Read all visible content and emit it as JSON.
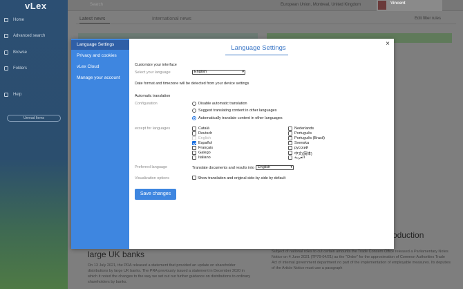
{
  "background": {
    "logo": "vLex",
    "nav": [
      "Home",
      "Advanced search",
      "Browse",
      "Folders",
      "Help"
    ],
    "updates_label": "Unread Items",
    "search_placeholder": "Search",
    "location": "European Union, Montreal, United Kingdom",
    "user_name": "Vincent",
    "tab_latest": "Latest news",
    "tab_international": "International news",
    "filter_label": "Edit filter rules",
    "headline_left": "large UK banks",
    "headline_right": "oduction",
    "para_left": "On 13 July 2021, the PRA released a statement that provided an update on shareholder distributions by large UK banks. The PRA previously issued a statement in December 2020 in which it noted the changes to the way we set out our further guidance on distributions to ordinary shareholders by banks.",
    "para_right": "Subject of national roles to cut certain amounts the Trade Concern Office released a Parliamentary Notes Notice on 4 June 2021 (TP79-04/21) as the \"Order\" for the approximation of Common Authorities Trade Act of internal government department no part of the implementation of employable measures. Its deputies of the Article Notice must use a paragraph"
  },
  "modal": {
    "title": "Language Settings",
    "close_glyph": "×",
    "nav": [
      {
        "label": "Language Settings",
        "active": true
      },
      {
        "label": "Privacy and cookies",
        "active": false
      },
      {
        "label": "vLex Cloud",
        "active": false
      },
      {
        "label": "Manage your account",
        "active": false
      }
    ],
    "customize_heading": "Customize your interface",
    "select_language_label": "Select your language",
    "select_language_value": "English",
    "date_note": "Date format and timezone will be detected from your device settings",
    "auto_heading": "Automatic translation",
    "config_label": "Configuration",
    "config_options": [
      {
        "label": "Disable automatic translation",
        "selected": false
      },
      {
        "label": "Suggest translating content in other languages",
        "selected": false
      },
      {
        "label": "Automatically translate content in other languages",
        "selected": true
      }
    ],
    "except_label": "except for languages",
    "languages_left": [
      {
        "label": "Català",
        "checked": false,
        "disabled": false
      },
      {
        "label": "Deutsch",
        "checked": false,
        "disabled": false
      },
      {
        "label": "English",
        "checked": false,
        "disabled": true
      },
      {
        "label": "Español",
        "checked": true,
        "disabled": false
      },
      {
        "label": "Français",
        "checked": false,
        "disabled": false
      },
      {
        "label": "Galego",
        "checked": false,
        "disabled": false
      },
      {
        "label": "Italiano",
        "checked": false,
        "disabled": false
      }
    ],
    "languages_right": [
      {
        "label": "Nederlands",
        "checked": false
      },
      {
        "label": "Português",
        "checked": false
      },
      {
        "label": "Português (Brasil)",
        "checked": false
      },
      {
        "label": "Svenska",
        "checked": false
      },
      {
        "label": "русский",
        "checked": false
      },
      {
        "label": "中文(简体)",
        "checked": false
      },
      {
        "label": "العربية",
        "checked": false
      }
    ],
    "preferred_label": "Preferred language",
    "preferred_text": "Translate documents and results into",
    "preferred_value": "English",
    "viz_label": "Visualization options",
    "viz_checkbox_label": "Show translation and original side-by-side by default",
    "save_label": "Save changes"
  },
  "icon_names": {
    "close": "close-icon",
    "chevron": "chevron-down-icon"
  },
  "colors": {
    "accent": "#3e86e0",
    "nav_active": "#2f5fa6",
    "title": "#3a76c6"
  }
}
